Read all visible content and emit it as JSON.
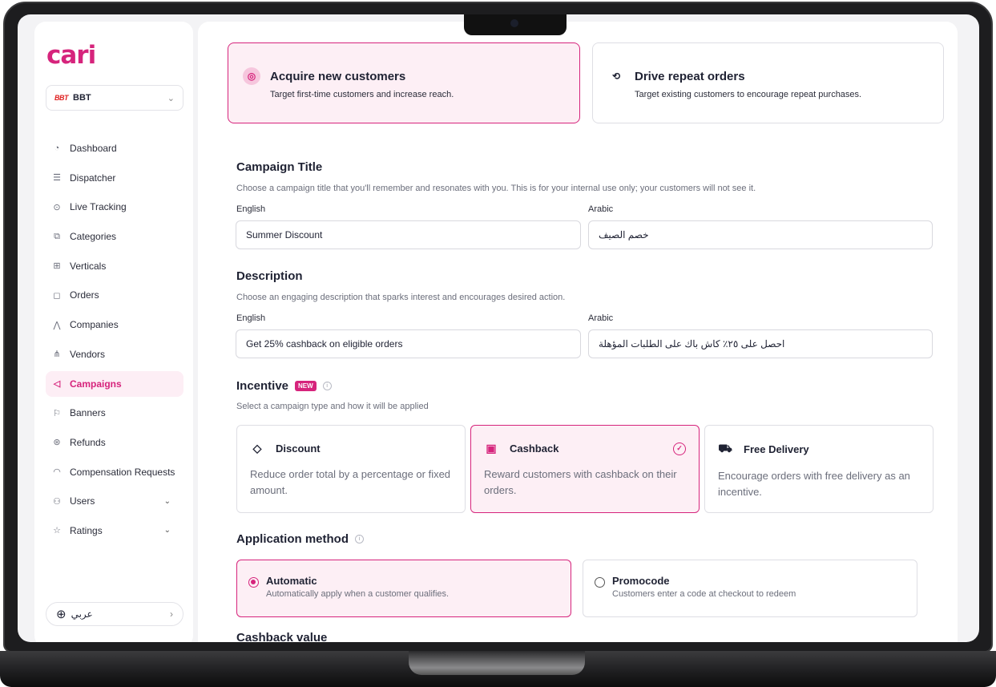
{
  "sidebar": {
    "logo": "cari",
    "brand": {
      "logo_text": "BBT",
      "name": "BBT"
    },
    "items": [
      {
        "label": "Dashboard",
        "icon": "gauge-icon"
      },
      {
        "label": "Dispatcher",
        "icon": "list-icon"
      },
      {
        "label": "Live Tracking",
        "icon": "play-circle-icon"
      },
      {
        "label": "Categories",
        "icon": "categories-icon"
      },
      {
        "label": "Verticals",
        "icon": "verticals-icon"
      },
      {
        "label": "Orders",
        "icon": "bag-icon"
      },
      {
        "label": "Companies",
        "icon": "companies-icon"
      },
      {
        "label": "Vendors",
        "icon": "vendors-icon"
      },
      {
        "label": "Campaigns",
        "icon": "megaphone-icon",
        "active": true
      },
      {
        "label": "Banners",
        "icon": "banner-icon"
      },
      {
        "label": "Refunds",
        "icon": "dollar-circle-icon"
      },
      {
        "label": "Compensation Requests",
        "icon": "compensation-icon"
      },
      {
        "label": "Users",
        "icon": "users-icon",
        "expandable": true
      },
      {
        "label": "Ratings",
        "icon": "star-icon",
        "expandable": true
      }
    ],
    "language": "عربي"
  },
  "goals": [
    {
      "title": "Acquire new customers",
      "desc": "Target first-time customers and increase reach.",
      "selected": true
    },
    {
      "title": "Drive repeat orders",
      "desc": "Target existing customers to encourage repeat purchases.",
      "selected": false
    }
  ],
  "campaign_title": {
    "heading": "Campaign Title",
    "sub": "Choose a campaign title that you'll remember and resonates with you. This is for your internal use only; your customers will not see it.",
    "english_label": "English",
    "arabic_label": "Arabic",
    "english_value": "Summer Discount",
    "arabic_value": "خصم الصيف"
  },
  "description": {
    "heading": "Description",
    "sub": "Choose an engaging description that sparks interest and encourages desired action.",
    "english_label": "English",
    "arabic_label": "Arabic",
    "english_value": "Get 25% cashback on eligible orders",
    "arabic_value": "احصل على ٢٥٪ كاش باك على الطلبات المؤهلة"
  },
  "incentive": {
    "heading": "Incentive",
    "badge": "NEW",
    "sub": "Select a campaign type and how it will be applied",
    "options": [
      {
        "title": "Discount",
        "desc": "Reduce order total by a percentage or fixed amount.",
        "selected": false
      },
      {
        "title": "Cashback",
        "desc": "Reward customers with cashback on their orders.",
        "selected": true
      },
      {
        "title": "Free Delivery",
        "desc": "Encourage orders with free delivery as an incentive.",
        "selected": false
      }
    ]
  },
  "application_method": {
    "heading": "Application method",
    "options": [
      {
        "title": "Automatic",
        "desc": "Automatically apply when a customer qualifies.",
        "selected": true
      },
      {
        "title": "Promocode",
        "desc": "Customers enter a code at checkout to redeem",
        "selected": false
      }
    ]
  },
  "cashback_value": {
    "heading": "Cashback value"
  },
  "colors": {
    "accent": "#d6247c",
    "accent_bg": "#fdeff5"
  }
}
